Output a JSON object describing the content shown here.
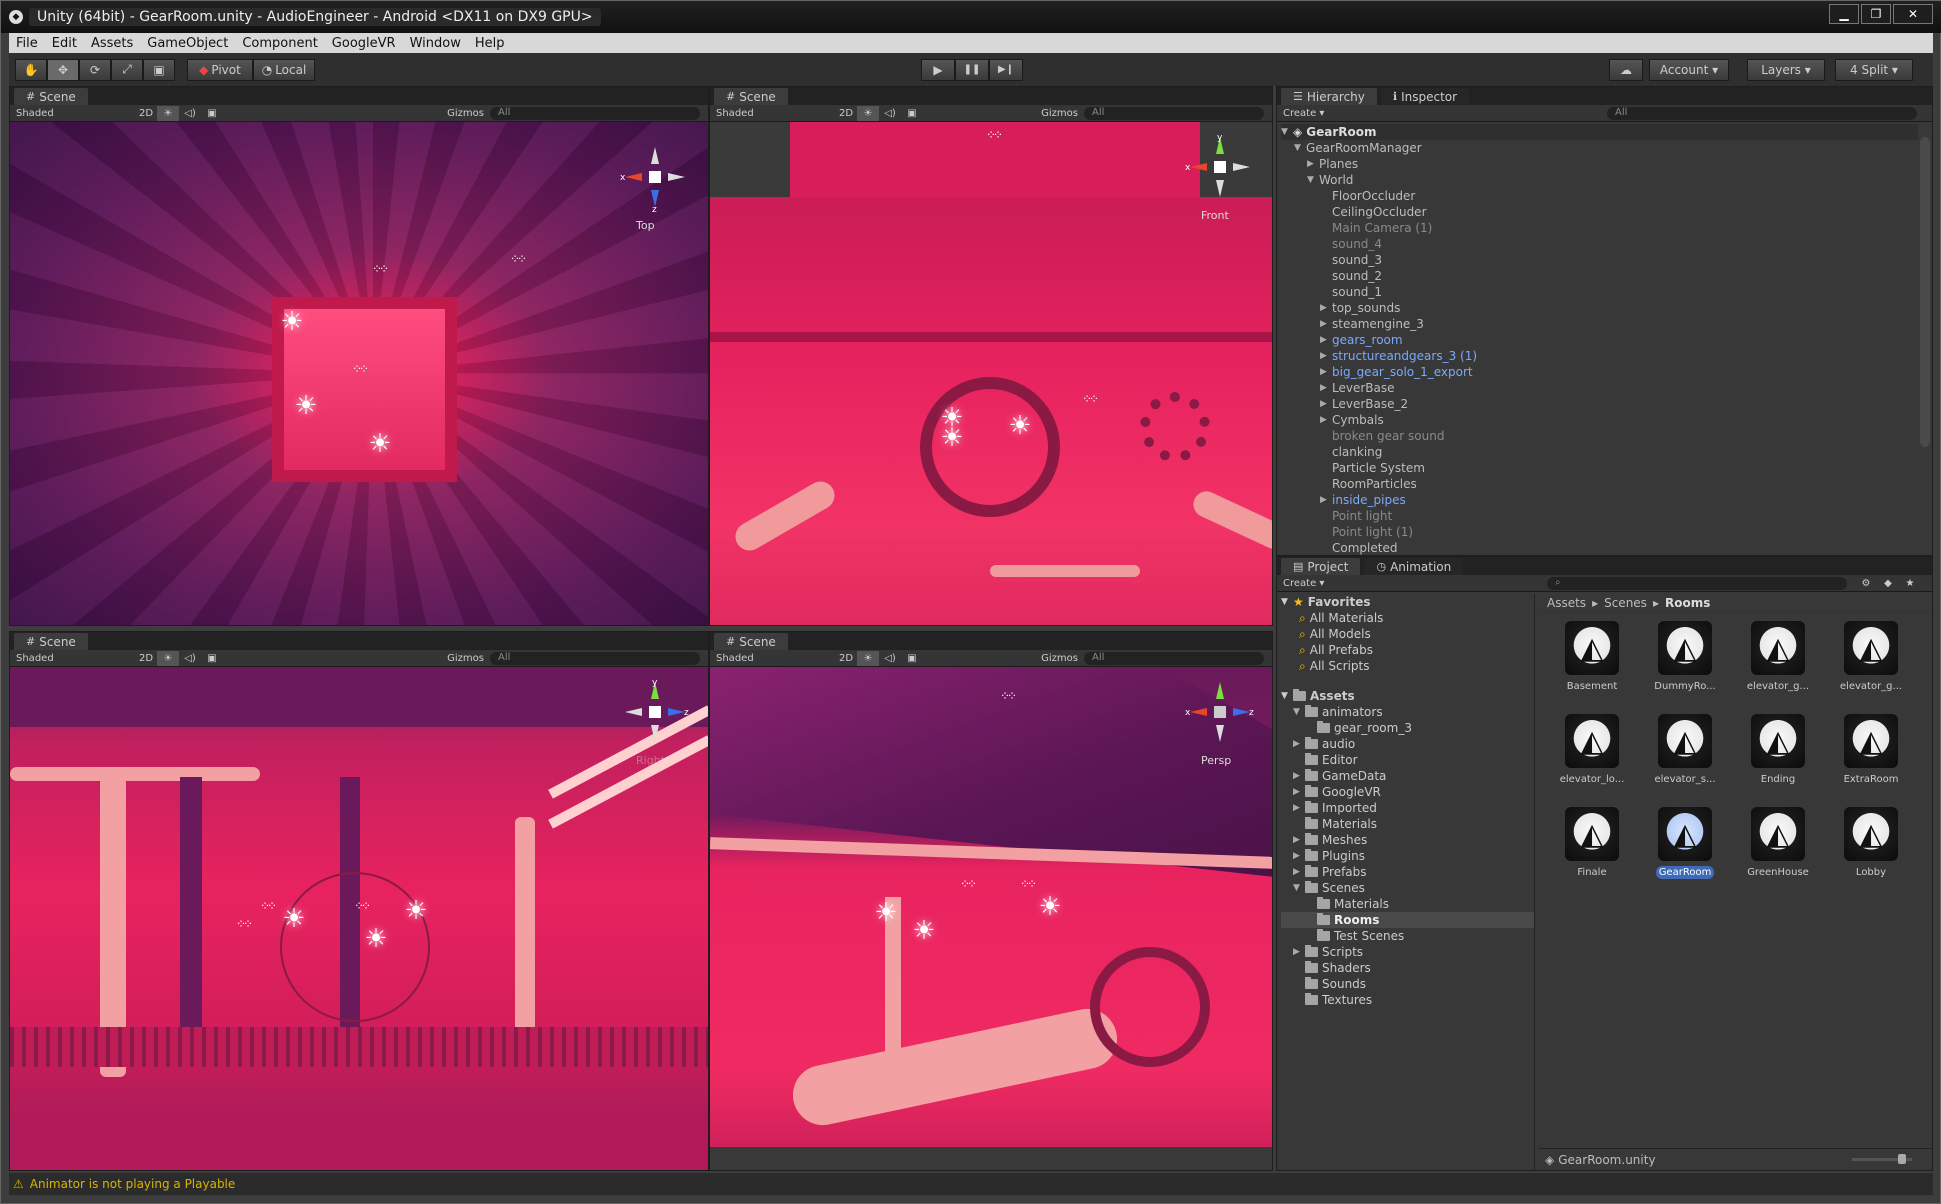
{
  "window": {
    "title": "Unity (64bit) - GearRoom.unity - AudioEngineer - Android <DX11 on DX9 GPU>",
    "minimize": "▁",
    "maximize": "❐",
    "close": "✕"
  },
  "menu": [
    "File",
    "Edit",
    "Assets",
    "GameObject",
    "Component",
    "GoogleVR",
    "Window",
    "Help"
  ],
  "toolbar": {
    "pivot": "Pivot",
    "local": "Local",
    "play": "▶",
    "pause": "❚❚",
    "step": "▶❙",
    "account": "Account",
    "layers": "Layers",
    "layout": "4 Split"
  },
  "scene": {
    "tab": "Scene",
    "shading": "Shaded",
    "mode2d": "2D",
    "gizmos": "Gizmos",
    "search": "All",
    "views": [
      "Top",
      "Front",
      "Right",
      "Persp"
    ]
  },
  "hierarchy": {
    "tab": "Hierarchy",
    "inspector_tab": "Inspector",
    "create": "Create",
    "search": "All",
    "scene_name": "GearRoom",
    "items": [
      {
        "name": "GearRoomManager",
        "indent": 1,
        "arrow": "▼",
        "style": ""
      },
      {
        "name": "Planes",
        "indent": 2,
        "arrow": "▶",
        "style": ""
      },
      {
        "name": "World",
        "indent": 2,
        "arrow": "▼",
        "style": ""
      },
      {
        "name": "FloorOccluder",
        "indent": 3,
        "arrow": "",
        "style": ""
      },
      {
        "name": "CeilingOccluder",
        "indent": 3,
        "arrow": "",
        "style": ""
      },
      {
        "name": "Main Camera (1)",
        "indent": 3,
        "arrow": "",
        "style": "dim"
      },
      {
        "name": "sound_4",
        "indent": 3,
        "arrow": "",
        "style": "dim"
      },
      {
        "name": "sound_3",
        "indent": 3,
        "arrow": "",
        "style": ""
      },
      {
        "name": "sound_2",
        "indent": 3,
        "arrow": "",
        "style": ""
      },
      {
        "name": "sound_1",
        "indent": 3,
        "arrow": "",
        "style": ""
      },
      {
        "name": "top_sounds",
        "indent": 3,
        "arrow": "▶",
        "style": ""
      },
      {
        "name": "steamengine_3",
        "indent": 3,
        "arrow": "▶",
        "style": ""
      },
      {
        "name": "gears_room",
        "indent": 3,
        "arrow": "▶",
        "style": "pf"
      },
      {
        "name": "structureandgears_3 (1)",
        "indent": 3,
        "arrow": "▶",
        "style": "pf"
      },
      {
        "name": "big_gear_solo_1_export",
        "indent": 3,
        "arrow": "▶",
        "style": "pf"
      },
      {
        "name": "LeverBase",
        "indent": 3,
        "arrow": "▶",
        "style": ""
      },
      {
        "name": "LeverBase_2",
        "indent": 3,
        "arrow": "▶",
        "style": ""
      },
      {
        "name": "Cymbals",
        "indent": 3,
        "arrow": "▶",
        "style": ""
      },
      {
        "name": "broken gear sound",
        "indent": 3,
        "arrow": "",
        "style": "dim"
      },
      {
        "name": "clanking",
        "indent": 3,
        "arrow": "",
        "style": ""
      },
      {
        "name": "Particle System",
        "indent": 3,
        "arrow": "",
        "style": ""
      },
      {
        "name": "RoomParticles",
        "indent": 3,
        "arrow": "",
        "style": ""
      },
      {
        "name": "inside_pipes",
        "indent": 3,
        "arrow": "▶",
        "style": "pf"
      },
      {
        "name": "Point light",
        "indent": 3,
        "arrow": "",
        "style": "dim"
      },
      {
        "name": "Point light (1)",
        "indent": 3,
        "arrow": "",
        "style": "dim"
      },
      {
        "name": "Completed",
        "indent": 3,
        "arrow": "",
        "style": ""
      }
    ]
  },
  "project": {
    "tab": "Project",
    "animation_tab": "Animation",
    "create": "Create",
    "favorites_label": "Favorites",
    "favorites": [
      "All Materials",
      "All Models",
      "All Prefabs",
      "All Scripts"
    ],
    "assets_label": "Assets",
    "folders": [
      {
        "name": "animators",
        "indent": 1,
        "arrow": "▼"
      },
      {
        "name": "gear_room_3",
        "indent": 2,
        "arrow": ""
      },
      {
        "name": "audio",
        "indent": 1,
        "arrow": "▶"
      },
      {
        "name": "Editor",
        "indent": 1,
        "arrow": ""
      },
      {
        "name": "GameData",
        "indent": 1,
        "arrow": "▶"
      },
      {
        "name": "GoogleVR",
        "indent": 1,
        "arrow": "▶"
      },
      {
        "name": "Imported",
        "indent": 1,
        "arrow": "▶"
      },
      {
        "name": "Materials",
        "indent": 1,
        "arrow": ""
      },
      {
        "name": "Meshes",
        "indent": 1,
        "arrow": "▶"
      },
      {
        "name": "Plugins",
        "indent": 1,
        "arrow": "▶"
      },
      {
        "name": "Prefabs",
        "indent": 1,
        "arrow": "▶"
      },
      {
        "name": "Scenes",
        "indent": 1,
        "arrow": "▼"
      },
      {
        "name": "Materials",
        "indent": 2,
        "arrow": ""
      },
      {
        "name": "Rooms",
        "indent": 2,
        "arrow": "",
        "selected": true
      },
      {
        "name": "Test Scenes",
        "indent": 2,
        "arrow": ""
      },
      {
        "name": "Scripts",
        "indent": 1,
        "arrow": "▶"
      },
      {
        "name": "Shaders",
        "indent": 1,
        "arrow": ""
      },
      {
        "name": "Sounds",
        "indent": 1,
        "arrow": ""
      },
      {
        "name": "Textures",
        "indent": 1,
        "arrow": ""
      }
    ],
    "breadcrumb": [
      "Assets",
      "Scenes",
      "Rooms"
    ],
    "assets": [
      "Basement",
      "DummyRo...",
      "elevator_g...",
      "elevator_g...",
      "elevator_lo...",
      "elevator_s...",
      "Ending",
      "ExtraRoom",
      "Finale",
      "GearRoom",
      "GreenHouse",
      "Lobby"
    ],
    "selected_asset": "GearRoom",
    "footer": "GearRoom.unity"
  },
  "status": {
    "warning_icon": "⚠",
    "message": "Animator is not playing a Playable"
  },
  "colors": {
    "scene_pink": "#e8235f",
    "scene_purple": "#6a1a5a",
    "prefab_blue": "#7ca8ff",
    "warning": "#d8b400"
  }
}
